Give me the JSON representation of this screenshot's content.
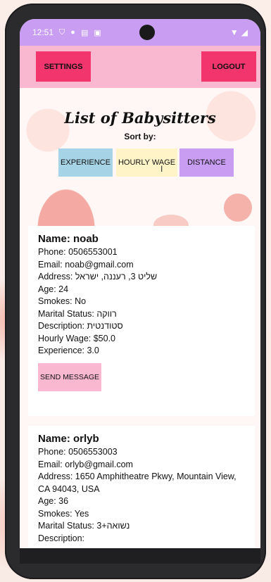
{
  "status_bar": {
    "time": "12:51",
    "icons_left": [
      "shield-icon",
      "location-icon",
      "clipboard-icon",
      "notification-icon"
    ],
    "icons_right": [
      "wifi-icon",
      "signal-icon"
    ]
  },
  "app_bar": {
    "settings_label": "SETTINGS",
    "logout_label": "LOGOUT"
  },
  "header": {
    "title": "List of Babysitters",
    "sort_label": "Sort by:",
    "sort_options": [
      "EXPERIENCE",
      "HOURLY WAGE",
      "DISTANCE"
    ]
  },
  "babysitters": [
    {
      "name": "Name: noab",
      "phone": "Phone: 0506553001",
      "email": "Email: noab@gmail.com",
      "address": "Address: שליט 3, רעננה, ישראל",
      "age": "Age: 24",
      "smokes": "Smokes: No",
      "marital": "Marital Status: רווקה",
      "description": "Description: סטודנטית",
      "wage": "Hourly Wage: $50.0",
      "experience": "Experience:  3.0",
      "action": "SEND MESSAGE"
    },
    {
      "name": "Name: orlyb",
      "phone": "Phone: 0506553003",
      "email": "Email: orlyb@gmail.com",
      "address": "Address: 1650 Amphitheatre Pkwy, Mountain View, CA 94043, USA",
      "age": "Age: 36",
      "smokes": "Smokes: Yes",
      "marital": "Marital Status: נשואה+3",
      "description": "Description:"
    }
  ],
  "colors": {
    "status_bar": "#c89df2",
    "app_bar": "#f9b8cf",
    "top_button": "#f2356d",
    "sort_experience": "#a7d3e6",
    "sort_wage": "#fff3c8",
    "sort_distance": "#c89df2",
    "send_button": "#f9b8cf"
  }
}
